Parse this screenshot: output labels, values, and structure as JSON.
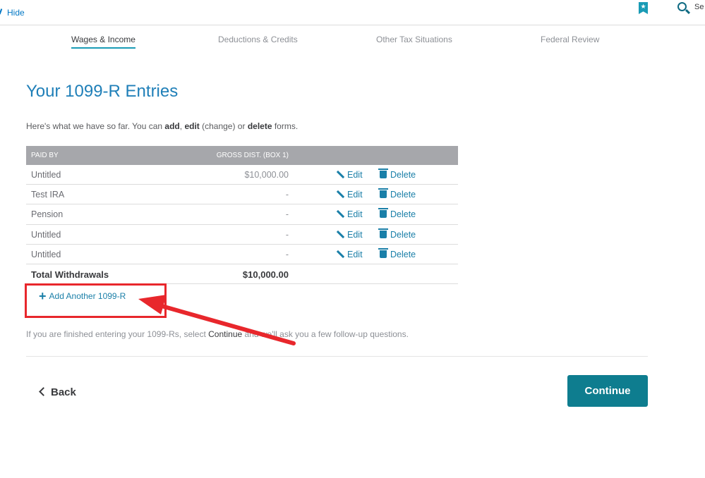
{
  "topbar": {
    "hide_label": "Hide",
    "bookmark_glyph": "★",
    "search_label": "Se"
  },
  "steps": [
    {
      "label": "Wages & Income",
      "active": true
    },
    {
      "label": "Deductions & Credits",
      "active": false
    },
    {
      "label": "Other Tax Situations",
      "active": false
    },
    {
      "label": "Federal Review",
      "active": false
    }
  ],
  "page": {
    "title": "Your 1099-R Entries",
    "intro": {
      "prefix": "Here's what we have so far. You can ",
      "add": "add",
      "comma": ", ",
      "edit": "edit",
      "change": " (change) or ",
      "delete": "delete",
      "suffix": " forms."
    }
  },
  "table": {
    "headers": {
      "paid_by": "PAID BY",
      "gross": "GROSS DIST. (BOX 1)"
    },
    "rows": [
      {
        "payer": "Untitled",
        "amount": "$10,000.00"
      },
      {
        "payer": "Test IRA",
        "amount": "-"
      },
      {
        "payer": "Pension",
        "amount": "-"
      },
      {
        "payer": "Untitled",
        "amount": "-"
      },
      {
        "payer": "Untitled",
        "amount": "-"
      }
    ],
    "edit_label": "Edit",
    "delete_label": "Delete",
    "total_label": "Total Withdrawals",
    "total_amount": "$10,000.00"
  },
  "add_another": {
    "plus": "+",
    "label": "Add Another 1099-R"
  },
  "note": {
    "prefix": "If you are finished entering your 1099-Rs, select ",
    "continue_word": "Continue",
    "suffix": " and we'll ask you a few follow-up questions."
  },
  "nav": {
    "back_label": "Back",
    "continue_label": "Continue"
  },
  "colors": {
    "accent": "#1a7fa8",
    "primary_button": "#0e7d8f",
    "annotation": "#e8272c"
  }
}
